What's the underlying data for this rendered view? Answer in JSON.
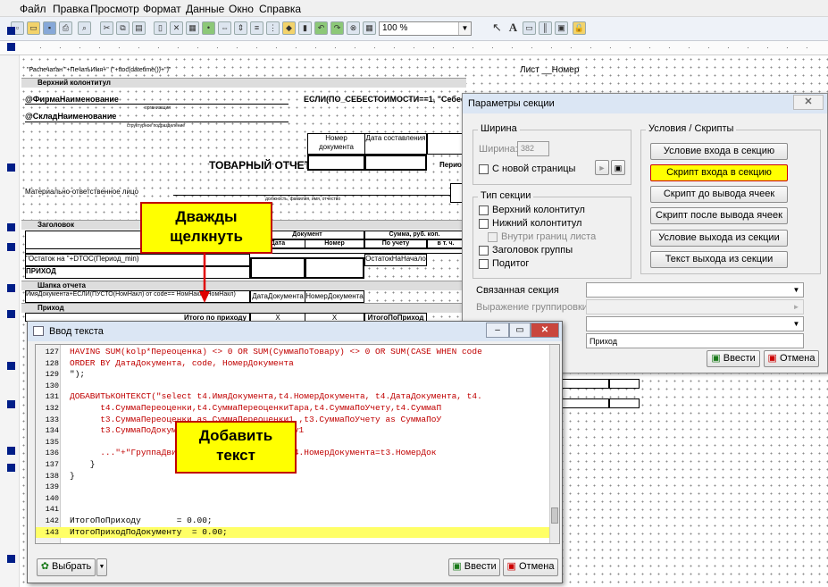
{
  "menu": [
    "Файл",
    "Правка",
    "Просмотр",
    "Формат",
    "Данные",
    "Окно",
    "Справка"
  ],
  "toolbar": {
    "zoom": "100 %",
    "text_tool": "A"
  },
  "sheet": {
    "printed_line": "\"Распечатан \"+ПечатьИмя+\"   (\"+ttoc(datetime())+\")\"",
    "sheet_no": "Лист __Номер",
    "band_top": "Верхний колонтитул",
    "firm": "@ФирмаНаименование",
    "firm_sub": "организация",
    "cost_expr": "ЕСЛИ(ПО_СЕБЕСТОИМОСТИ==1, \"Себестоим",
    "store": "@СкладНаименование",
    "store_sub": "структурное подразделение",
    "doc_no_hdr": "Номер документа",
    "doc_date_hdr": "Дата составления",
    "report_title": "ТОВАРНЫЙ ОТЧЕТ",
    "period": "Перио",
    "resp_person": "Материально-ответственное лицо",
    "resp_sub": "должность, фамилия, имя, отчество",
    "band_header": "Заголовок",
    "col_name": "Наимено",
    "col_document": "Документ",
    "col_sum": "Сумма, руб. коп.",
    "col_date": "Дата",
    "col_number": "Номер",
    "col_by_acc": "По учету",
    "col_incl": "в т. ч.",
    "remainder": "\"Остаток на \"+DTOC(Период_min)",
    "remainder_val": "ОстатокНаНачало",
    "income": "ПРИХОД",
    "band_report_cap": "Шапка отчета",
    "doc_expr": "ИмяДокумента+ЕСЛИ(ПУСТО(НомНакл) от code==",
    "doc_expr2": "НомНакл+НомНакл)",
    "doc_date_cell": "ДатаДокумента",
    "doc_no_cell": "НомерДокумента",
    "band_income": "Приход",
    "income_total": "Итого по приходу",
    "x1": "Х",
    "x2": "Х",
    "income_total_val": "ИтогоПоПриход"
  },
  "params_dialog": {
    "title": "Параметры секции",
    "width_group": "Ширина",
    "width_label": "Ширина:",
    "width_value": "382",
    "new_page": "С новой страницы",
    "section_type_group": "Тип секции",
    "types": [
      "Верхний колонтитул",
      "Нижний колонтитул",
      "Внутри границ листа",
      "Заголовок группы",
      "Подитог"
    ],
    "conditions_group": "Условия / Скрипты",
    "btn_entry_cond": "Условие входа в секцию",
    "btn_entry_script": "Скрипт входа в секцию",
    "btn_before_cells": "Скрипт до вывода ячеек",
    "btn_after_cells": "Скрипт после вывода ячеек",
    "btn_exit_cond": "Условие выхода из секции",
    "btn_exit_text": "Текст выхода из секции",
    "linked_section": "Связанная секция",
    "group_expr": "Выражение группировки",
    "section_name": "Приход",
    "ok": "Ввести",
    "cancel": "Отмена"
  },
  "text_window": {
    "title": "Ввод текста",
    "lines": [
      {
        "n": "127",
        "t": "HAVING SUM(kolp*Переоценка) <> 0 OR SUM(СуммаПоТовару) <> 0 OR SUM(CASE WHEN code",
        "c": "red"
      },
      {
        "n": "128",
        "t": "ORDER BY ДатаДокумента, code, НомерДокумента",
        "c": "red"
      },
      {
        "n": "129",
        "t": "\");",
        "c": ""
      },
      {
        "n": "130",
        "t": "",
        "c": ""
      },
      {
        "n": "131",
        "t": "ДОБАВИТЬКОНТЕКСТ(\"select t4.ИмяДокумента,t4.НомерДокумента, t4.ДатаДокумента, t4.",
        "c": "red"
      },
      {
        "n": "132",
        "t": "      t4.СуммаПереоценки,t4.СуммаПереоценкиТара,t4.СуммаПоУчету,t4.СуммаП",
        "c": "red"
      },
      {
        "n": "133",
        "t": "      t3.СуммаПереоценки as СуммаПереоценки1 ,t3.СуммаПоУчету as СуммаПоУ",
        "c": "red"
      },
      {
        "n": "134",
        "t": "      t3.СуммаПоДокументу as СуммаПоДокументу1",
        "c": "red"
      },
      {
        "n": "135",
        "t": "",
        "c": ""
      },
      {
        "n": "136",
        "t": "      ...\"+\"ГруппаДвижения...\"+\"ц3+\" t3 on t4.НомерДокумента=t3.НомерДок",
        "c": "red"
      },
      {
        "n": "137",
        "t": "    }",
        "c": ""
      },
      {
        "n": "138",
        "t": "}",
        "c": ""
      },
      {
        "n": "139",
        "t": "",
        "c": ""
      },
      {
        "n": "140",
        "t": "",
        "c": ""
      },
      {
        "n": "141",
        "t": "",
        "c": ""
      },
      {
        "n": "142",
        "t": "ИтогоПоПриходу       = 0.00;",
        "c": ""
      },
      {
        "n": "143",
        "t": "ИтогоПриходПоДокументу  = 0.00;",
        "c": "yel"
      }
    ],
    "choose": "Выбрать",
    "ok": "Ввести",
    "cancel": "Отмена"
  },
  "callouts": {
    "double_click": "Дважды\nщелкнуть",
    "add_text": "Добавить\nтекст"
  }
}
